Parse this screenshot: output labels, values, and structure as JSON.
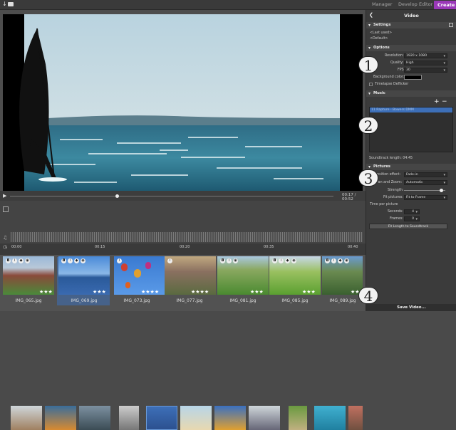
{
  "topbar": {
    "left_icons": [
      "download-icon",
      "folder-icon"
    ],
    "tabs": [
      {
        "label": "Manager"
      },
      {
        "label": "Develop"
      },
      {
        "label": "Editor"
      },
      {
        "label": "Create"
      }
    ]
  },
  "panel": {
    "title": "Video",
    "settings": {
      "header": "Settings",
      "items": [
        "<Last used>",
        "<Default>"
      ]
    },
    "options": {
      "header": "Options",
      "resolution_label": "Resolution:",
      "resolution_value": "1920 x 1080",
      "quality_label": "Quality:",
      "quality_value": "High",
      "fps_label": "FPS:",
      "fps_value": "30",
      "background_label": "Background color:",
      "timelapse_label": "Timelapse Deflicker"
    },
    "music": {
      "header": "Music",
      "track": "11 Rapture - Bowers DMM",
      "length": "Soundtrack length: 04:45"
    },
    "pictures": {
      "header": "Pictures",
      "transition_label": "Transition effect:",
      "transition_value": "Fade-in",
      "panzoom_label": "Pan and Zoom:",
      "panzoom_value": "Automatic",
      "strength_label": "Strength:",
      "strength_value": 0.9,
      "fit_label": "Fit pictures:",
      "fit_value": "Fit to Frame",
      "time_label": "Time per picture",
      "seconds_label": "Seconds:",
      "seconds_value": "4",
      "frames_label": "Frames:",
      "frames_value": "0",
      "fit_button": "Fit Length to Soundtrack"
    },
    "save_button": "Save Video..."
  },
  "callouts": [
    "1",
    "2",
    "3",
    "4"
  ],
  "scrub": {
    "time": "00:17 / 00:52",
    "progress": 0.33
  },
  "timeline": {
    "ticks": [
      "00:00",
      "00:15",
      "00:20",
      "00:35",
      "00:40"
    ]
  },
  "browser": {
    "files": [
      {
        "name": "IMG_065.jpg",
        "stars": "★★★"
      },
      {
        "name": "IMG_069.jpg",
        "stars": "★★★"
      },
      {
        "name": "IMG_073.jpg",
        "stars": "★★★★"
      },
      {
        "name": "IMG_077.jpg",
        "stars": "★★★★"
      },
      {
        "name": "IMG_081.jpg",
        "stars": "★★★"
      },
      {
        "name": "IMG_085.jpg",
        "stars": "★★★"
      },
      {
        "name": "IMG_089.jpg",
        "stars": "★★"
      }
    ]
  },
  "colors": {
    "accent": "#9a38b8",
    "selection": "#3d6fb8"
  }
}
